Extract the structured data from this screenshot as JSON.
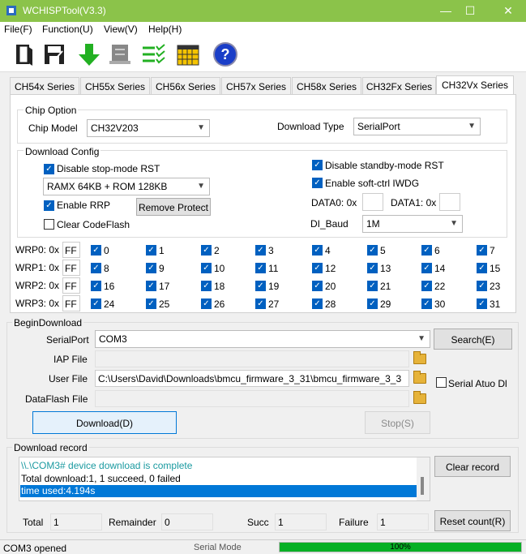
{
  "window": {
    "title": "WCHISPTool(V3.3)",
    "minimize": "—",
    "maximize": "☐",
    "close": "✕"
  },
  "menu": [
    "File(F)",
    "Function(U)",
    "View(V)",
    "Help(H)"
  ],
  "tabs": [
    "CH54x Series",
    "CH55x Series",
    "CH56x Series",
    "CH57x Series",
    "CH58x Series",
    "CH32Fx Series",
    "CH32Vx Series"
  ],
  "chip_option": {
    "legend": "Chip Option",
    "chip_model_label": "Chip Model",
    "chip_model_value": "CH32V203",
    "download_type_label": "Download Type",
    "download_type_value": "SerialPort"
  },
  "download_config": {
    "legend": "Download Config",
    "disable_stop_rst": "Disable stop-mode RST",
    "memory_value": "RAMX 64KB + ROM 128KB",
    "enable_rrp": "Enable RRP",
    "remove_protect": "Remove Protect",
    "clear_codeflash": "Clear CodeFlash",
    "disable_standby_rst": "Disable standby-mode RST",
    "enable_iwdg": "Enable soft-ctrl IWDG",
    "data0_label": "DATA0: 0x",
    "data1_label": "DATA1: 0x",
    "di_baud_label": "DI_Baud",
    "di_baud_value": "1M"
  },
  "wrp": {
    "rows": [
      {
        "label": "WRP0: 0x",
        "value": "FF",
        "bits": [
          "0",
          "1",
          "2",
          "3",
          "4",
          "5",
          "6",
          "7"
        ]
      },
      {
        "label": "WRP1: 0x",
        "value": "FF",
        "bits": [
          "8",
          "9",
          "10",
          "11",
          "12",
          "13",
          "14",
          "15"
        ]
      },
      {
        "label": "WRP2: 0x",
        "value": "FF",
        "bits": [
          "16",
          "17",
          "18",
          "19",
          "20",
          "21",
          "22",
          "23"
        ]
      },
      {
        "label": "WRP3: 0x",
        "value": "FF",
        "bits": [
          "24",
          "25",
          "26",
          "27",
          "28",
          "29",
          "30",
          "31"
        ]
      }
    ]
  },
  "begin_download": {
    "legend": "BeginDownload",
    "serialport_label": "SerialPort",
    "serialport_value": "COM3",
    "search_button": "Search(E)",
    "iap_label": "IAP File",
    "iap_value": "",
    "user_label": "User File",
    "user_value": "C:\\Users\\David\\Downloads\\bmcu_firmware_3_31\\bmcu_firmware_3_3",
    "dataflash_label": "DataFlash File",
    "dataflash_value": "",
    "serial_auto": "Serial Atuo Dl",
    "download_button": "Download(D)",
    "stop_button": "Stop(S)"
  },
  "download_record": {
    "legend": "Download record",
    "lines": [
      "\\\\.\\COM3# device download is complete",
      "Total download:1, 1 succeed, 0 failed",
      "time used:4.194s"
    ],
    "clear_button": "Clear record",
    "total_label": "Total",
    "total_value": "1",
    "remainder_label": "Remainder",
    "remainder_value": "0",
    "succ_label": "Succ",
    "succ_value": "1",
    "failure_label": "Failure",
    "failure_value": "1",
    "reset_button": "Reset count(R)"
  },
  "status": {
    "port": "COM3 opened",
    "mode": "Serial Mode",
    "progress_text": "100%",
    "progress": 1.0
  },
  "colors": {
    "titlebar": "#8bc34a",
    "accent": "#0078d7",
    "progress": "#06b025",
    "record_line1": "#1a9aa0"
  }
}
